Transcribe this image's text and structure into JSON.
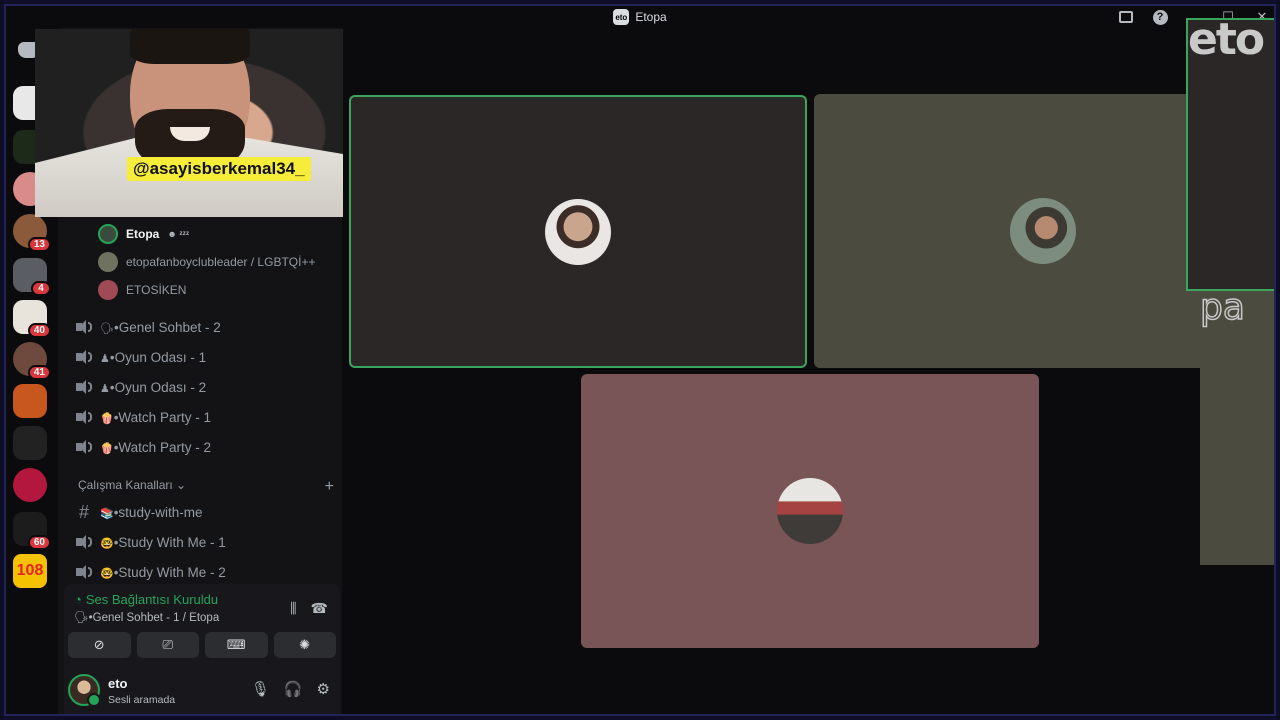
{
  "window": {
    "title": "Etopa",
    "server_abbrev": "eto"
  },
  "watermark": {
    "line1": "eto",
    "line2": "pa"
  },
  "rail": {
    "badges": [
      "13",
      "4",
      "40",
      "41",
      "60"
    ],
    "text_server": "108"
  },
  "facecam": {
    "handle": "@asayisberkemal34_"
  },
  "voice_users": [
    {
      "name": "Etopa",
      "self_icons": "☻ ᶻᶻᶻ"
    },
    {
      "name": "etopafanboyclubleader / LGBTQİ++"
    },
    {
      "name": "ETOSİKEN"
    }
  ],
  "channels": [
    {
      "emoji": "🗣",
      "name": "•Genel Sohbet - 2"
    },
    {
      "emoji": "♟",
      "name": "•Oyun Odası - 1"
    },
    {
      "emoji": "♟",
      "name": "•Oyun Odası - 2"
    },
    {
      "emoji": "🍿",
      "name": "•Watch Party - 1"
    },
    {
      "emoji": "🍿",
      "name": "•Watch Party - 2"
    }
  ],
  "category": {
    "name": "Çalışma Kanalları ⌄",
    "add": "+"
  },
  "study_channels": [
    {
      "emoji": "📚",
      "name": "•study-with-me"
    },
    {
      "emoji": "🤓",
      "name": "•Study With Me - 1"
    },
    {
      "emoji": "🤓",
      "name": "•Study With Me - 2"
    }
  ],
  "voice_panel": {
    "status": "Ses Bağlantısı Kuruldu",
    "location": "🗣•Genel Sohbet - 1 / Etopa"
  },
  "user": {
    "name": "eto",
    "status": "Sesli aramada"
  }
}
